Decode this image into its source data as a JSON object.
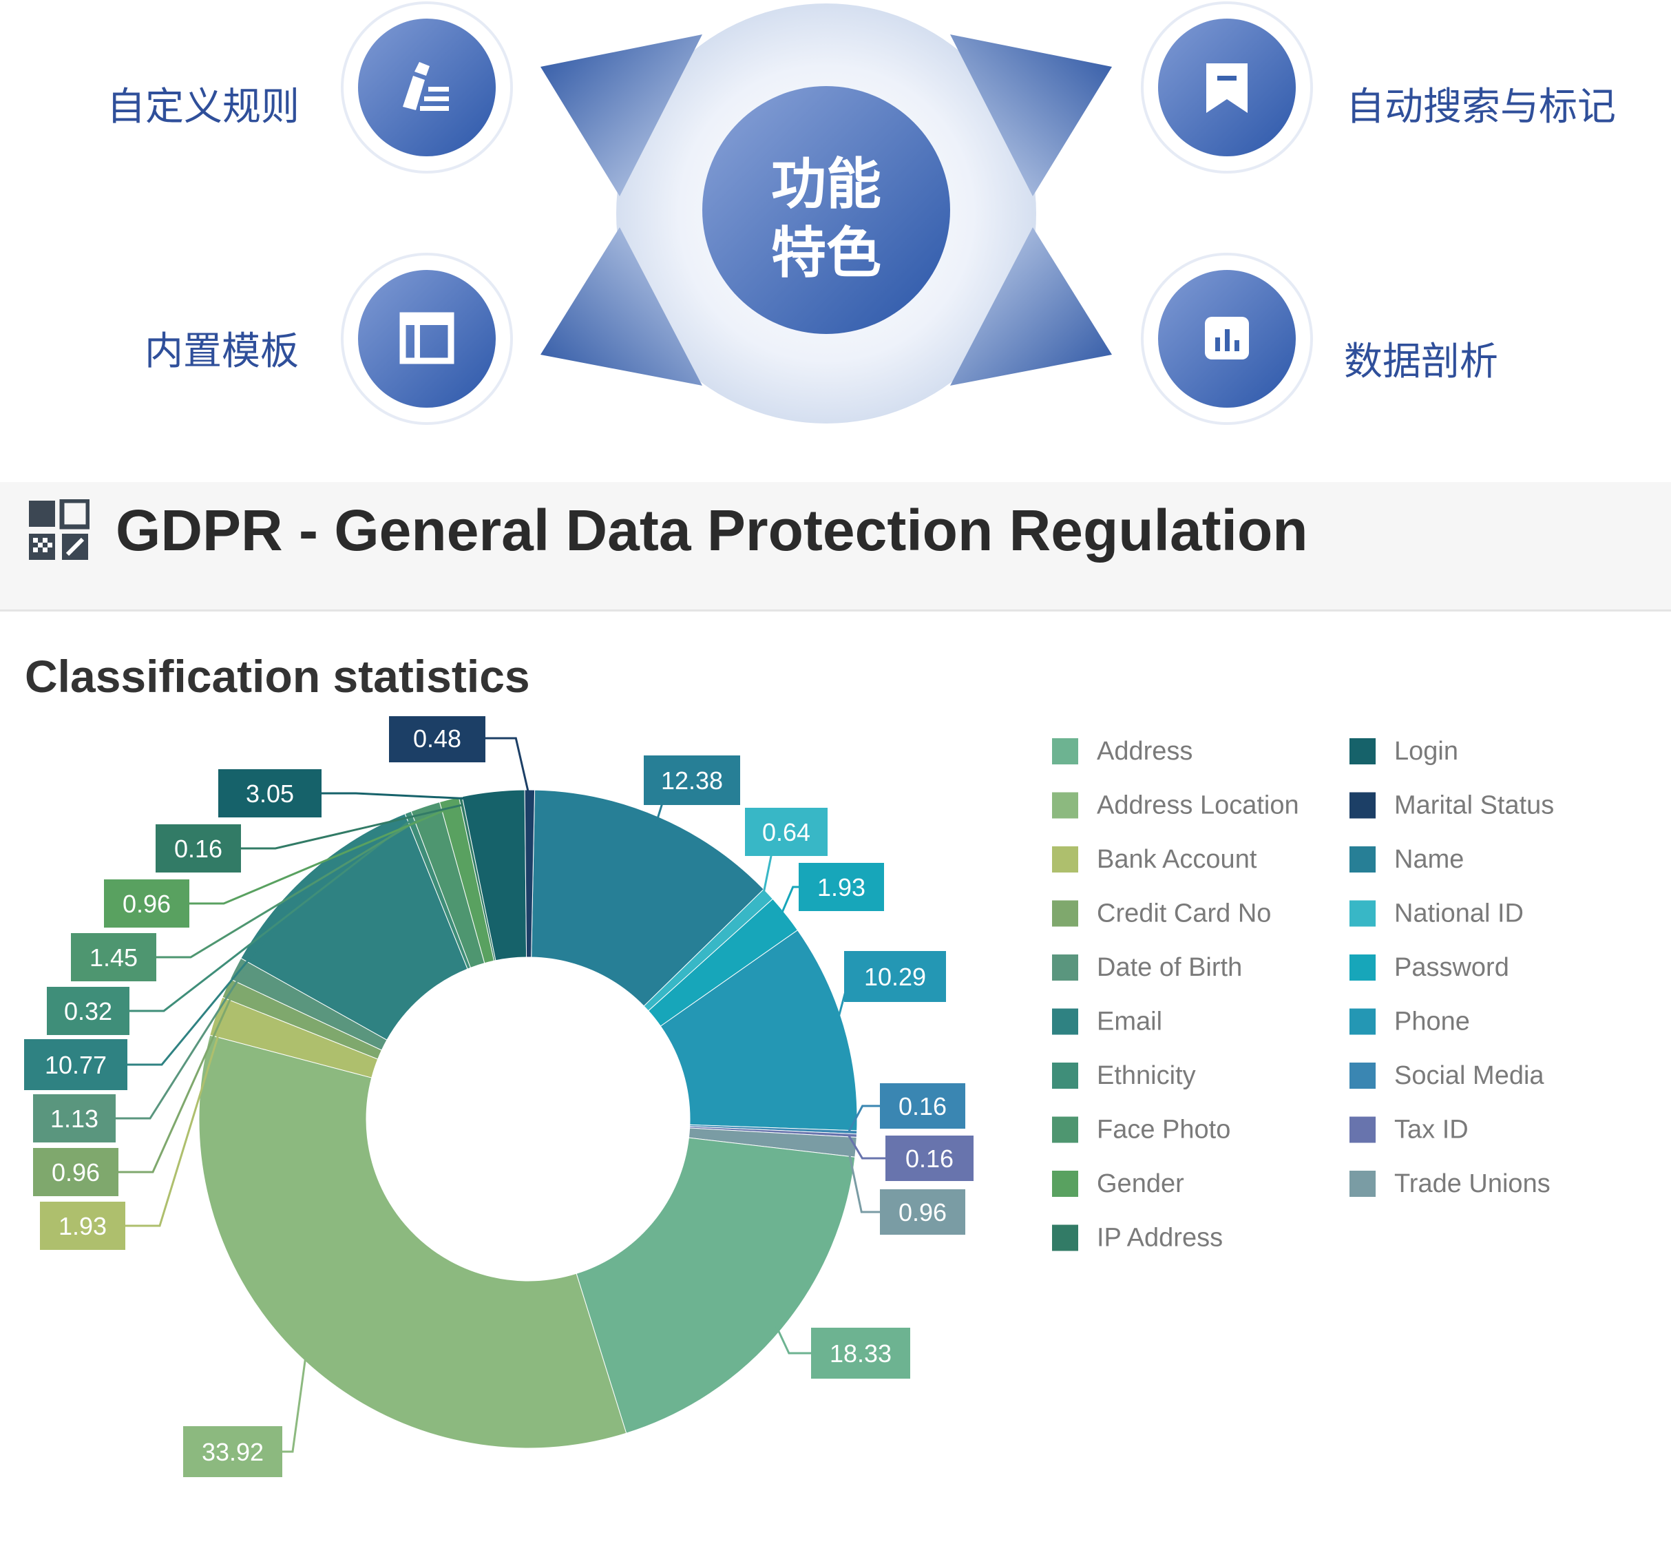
{
  "features": {
    "center_line1": "功能",
    "center_line2": "特色",
    "items": [
      {
        "label": "自定义规则",
        "icon": "edit-list-icon"
      },
      {
        "label": "自动搜索与标记",
        "icon": "bookmark-icon"
      },
      {
        "label": "内置模板",
        "icon": "template-icon"
      },
      {
        "label": "数据剖析",
        "icon": "bar-chart-icon"
      }
    ]
  },
  "header": {
    "title": "GDPR - General Data Protection Regulation",
    "icon": "dashboard-grid-icon"
  },
  "section": {
    "title": "Classification statistics"
  },
  "chart_data": {
    "type": "pie",
    "donut": true,
    "legend_position": "right",
    "slices": [
      {
        "name": "Name",
        "value": 12.38,
        "color": "#277f96"
      },
      {
        "name": "National ID",
        "value": 0.64,
        "color": "#38b7c6"
      },
      {
        "name": "Password",
        "value": 1.93,
        "color": "#17a6ba"
      },
      {
        "name": "Phone",
        "value": 10.29,
        "color": "#2497b4"
      },
      {
        "name": "Social Media",
        "value": 0.16,
        "color": "#3a86b2"
      },
      {
        "name": "Tax ID",
        "value": 0.16,
        "color": "#6874ad"
      },
      {
        "name": "Trade Unions",
        "value": 0.96,
        "color": "#7a9ca4"
      },
      {
        "name": "Address",
        "value": 18.33,
        "color": "#6db391"
      },
      {
        "name": "Address Location",
        "value": 33.92,
        "color": "#8cb97f"
      },
      {
        "name": "Bank Account",
        "value": 1.93,
        "color": "#aebf6d"
      },
      {
        "name": "Credit Card No",
        "value": 0.96,
        "color": "#7fa86d"
      },
      {
        "name": "Date of Birth",
        "value": 1.13,
        "color": "#5a967e"
      },
      {
        "name": "Email",
        "value": 10.77,
        "color": "#2f8282"
      },
      {
        "name": "Ethnicity",
        "value": 0.32,
        "color": "#3f8e79"
      },
      {
        "name": "Face Photo",
        "value": 1.45,
        "color": "#4e9670"
      },
      {
        "name": "Gender",
        "value": 0.96,
        "color": "#59a160"
      },
      {
        "name": "IP Address",
        "value": 0.16,
        "color": "#327b66"
      },
      {
        "name": "Login",
        "value": 3.05,
        "color": "#16626a"
      },
      {
        "name": "Marital Status",
        "value": 0.48,
        "color": "#1c3f66"
      }
    ],
    "legend": [
      "Address",
      "Address Location",
      "Bank Account",
      "Credit Card No",
      "Date of Birth",
      "Email",
      "Ethnicity",
      "Face Photo",
      "Gender",
      "IP Address",
      "Login",
      "Marital Status",
      "Name",
      "National ID",
      "Password",
      "Phone",
      "Social Media",
      "Tax ID",
      "Trade Unions"
    ]
  }
}
